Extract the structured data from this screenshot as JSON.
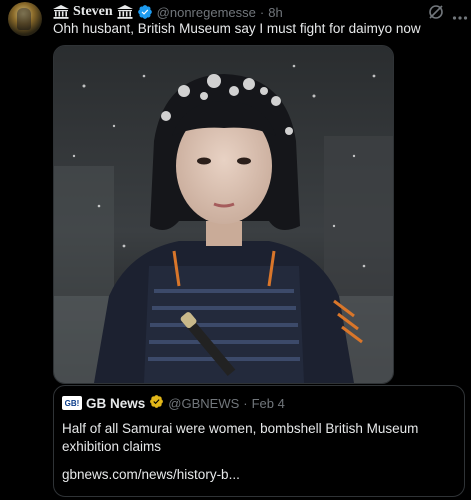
{
  "author": {
    "display_name": "Steven",
    "handle": "@nonregemesse",
    "separator": "·",
    "time": "8h",
    "verified": true,
    "badge_icon": "museum-icon"
  },
  "tweet": {
    "text": "Ohh husbant, British Museum say I must fight for daimyo now"
  },
  "media": {
    "description": "photo"
  },
  "quote": {
    "logo_text": "GB!",
    "display_name": "GB News",
    "verified_color": "#e2b719",
    "handle": "@GBNEWS",
    "separator": "·",
    "time": "Feb 4",
    "text": "Half of all Samurai were women, bombshell British Museum exhibition claims",
    "link": "gbnews.com/news/history-b..."
  },
  "colors": {
    "background": "#000000",
    "text": "#e7e9ea",
    "muted": "#71767b",
    "border": "#2f3336",
    "verified_blue": "#1d9bf0",
    "verified_gold": "#e2b719"
  }
}
